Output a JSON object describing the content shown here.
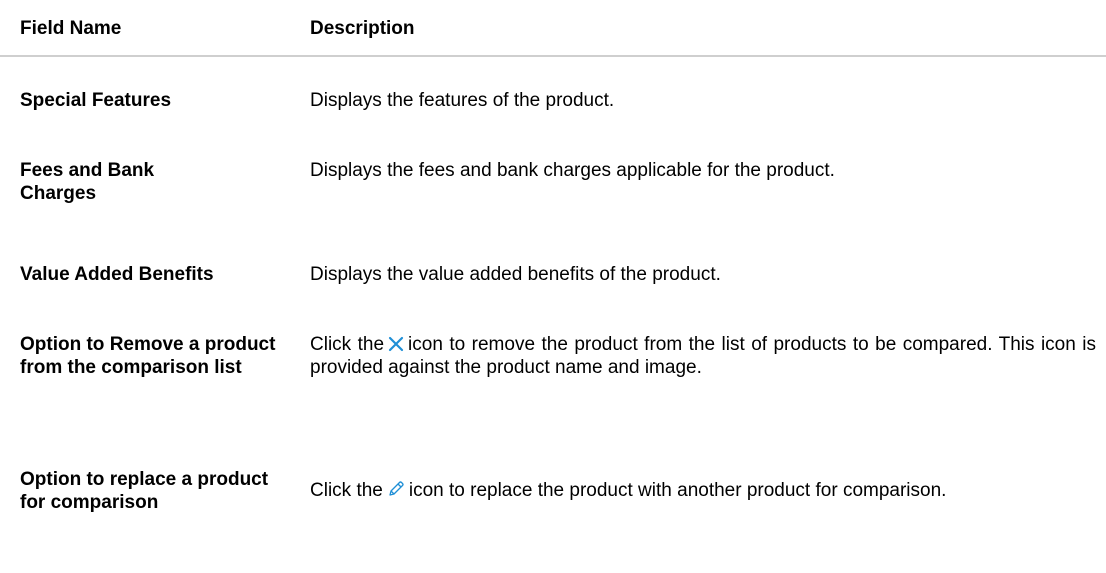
{
  "table": {
    "headers": {
      "field": "Field Name",
      "description": "Description"
    },
    "rows": [
      {
        "field": "Special Features",
        "description": "Displays the features of the product."
      },
      {
        "field": "Fees and Bank Charges",
        "description": "Displays the fees and bank charges applicable for the product."
      },
      {
        "field": "Value Added Benefits",
        "description": "Displays the value added benefits of the product."
      },
      {
        "field": "Option to Remove a product from the comparison list",
        "description_pre": "Click the",
        "icon": "close-x-icon",
        "description_post": "icon to remove the product from the list of products to be compared. This icon is provided against the product name and image."
      },
      {
        "field": "Option to replace a product for comparison",
        "description_pre": "Click the",
        "icon": "pencil-edit-icon",
        "description_post": "icon to replace the product with another product for comparison."
      }
    ]
  },
  "colors": {
    "icon_blue": "#1f8fd6",
    "rule": "#cfcfcf"
  }
}
